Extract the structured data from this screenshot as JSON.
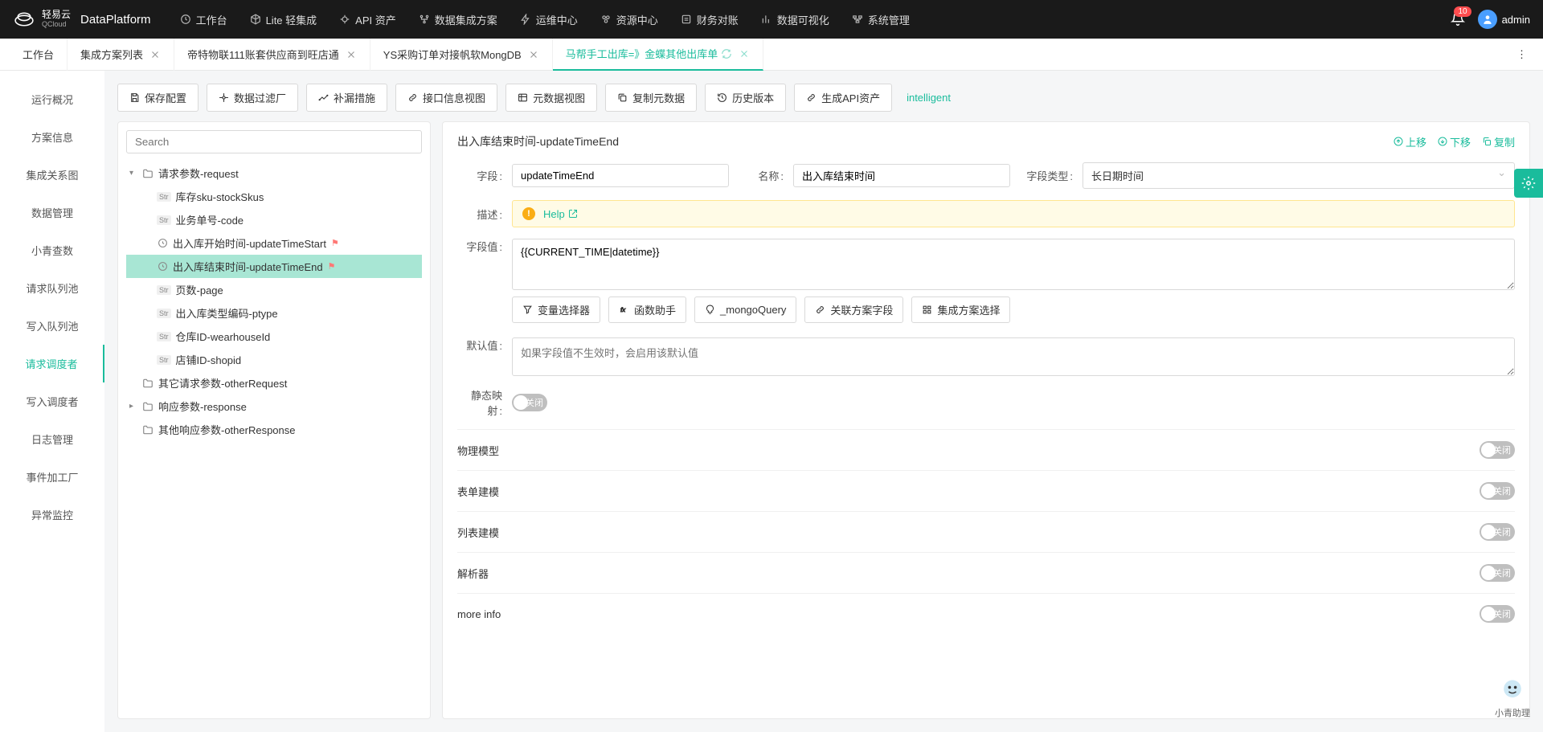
{
  "header": {
    "brand_cn": "轻易云",
    "brand_sub": "QCloud",
    "product": "DataPlatform",
    "nav": [
      {
        "icon": "clock",
        "label": "工作台"
      },
      {
        "icon": "cube",
        "label": "Lite 轻集成"
      },
      {
        "icon": "api",
        "label": "API 资产"
      },
      {
        "icon": "branch",
        "label": "数据集成方案"
      },
      {
        "icon": "bolt",
        "label": "运维中心"
      },
      {
        "icon": "resource",
        "label": "资源中心"
      },
      {
        "icon": "finance",
        "label": "财务对账"
      },
      {
        "icon": "chart",
        "label": "数据可视化"
      },
      {
        "icon": "system",
        "label": "系统管理"
      }
    ],
    "badge": "10",
    "user": "admin"
  },
  "tabs": [
    {
      "label": "工作台",
      "closable": false
    },
    {
      "label": "集成方案列表",
      "closable": true
    },
    {
      "label": "帝特物联111账套供应商到旺店通",
      "closable": true
    },
    {
      "label": "YS采购订单对接帆软MongDB",
      "closable": true
    },
    {
      "label": "马帮手工出库=》金蝶其他出库单",
      "closable": true,
      "active": true,
      "refresh": true
    }
  ],
  "sidebar": [
    "运行概况",
    "方案信息",
    "集成关系图",
    "数据管理",
    "小青查数",
    "请求队列池",
    "写入队列池",
    "请求调度者",
    "写入调度者",
    "日志管理",
    "事件加工厂",
    "异常监控"
  ],
  "sidebar_active_index": 7,
  "toolbar": [
    {
      "icon": "save",
      "label": "保存配置"
    },
    {
      "icon": "filter",
      "label": "数据过滤厂"
    },
    {
      "icon": "patch",
      "label": "补漏措施"
    },
    {
      "icon": "link",
      "label": "接口信息视图"
    },
    {
      "icon": "meta",
      "label": "元数据视图"
    },
    {
      "icon": "copy",
      "label": "复制元数据"
    },
    {
      "icon": "history",
      "label": "历史版本"
    },
    {
      "icon": "api",
      "label": "生成API资产"
    }
  ],
  "intelligent": "intelligent",
  "search_placeholder": "Search",
  "tree": {
    "root": [
      {
        "type": "folder",
        "label": "请求参数-request",
        "expanded": true,
        "children": [
          {
            "type": "str",
            "label": "库存sku-stockSkus"
          },
          {
            "type": "str",
            "label": "业务单号-code"
          },
          {
            "type": "clock",
            "label": "出入库开始时间-updateTimeStart",
            "flag": true
          },
          {
            "type": "clock",
            "label": "出入库结束时间-updateTimeEnd",
            "flag": true,
            "selected": true
          },
          {
            "type": "str",
            "label": "页数-page"
          },
          {
            "type": "str",
            "label": "出入库类型编码-ptype"
          },
          {
            "type": "str",
            "label": "仓库ID-wearhouseId"
          },
          {
            "type": "str",
            "label": "店铺ID-shopid"
          }
        ]
      },
      {
        "type": "folder",
        "label": "其它请求参数-otherRequest"
      },
      {
        "type": "folder",
        "label": "响应参数-response",
        "caret": true
      },
      {
        "type": "folder",
        "label": "其他响应参数-otherResponse"
      }
    ]
  },
  "detail": {
    "title": "出入库结束时间-updateTimeEnd",
    "actions": {
      "up": "上移",
      "down": "下移",
      "copy": "复制"
    },
    "labels": {
      "field": "字段",
      "name": "名称",
      "fieldType": "字段类型",
      "desc": "描述",
      "fieldValue": "字段值",
      "defaultValue": "默认值",
      "staticMap": "静态映射"
    },
    "field": "updateTimeEnd",
    "name": "出入库结束时间",
    "fieldType": "长日期时间",
    "help": "Help",
    "fieldValue": "{{CURRENT_TIME|datetime}}",
    "chips": [
      {
        "icon": "funnel",
        "label": "变量选择器"
      },
      {
        "icon": "fx",
        "label": "函数助手"
      },
      {
        "icon": "bulb",
        "label": "_mongoQuery"
      },
      {
        "icon": "link",
        "label": "关联方案字段"
      },
      {
        "icon": "grid",
        "label": "集成方案选择"
      }
    ],
    "defaultPlaceholder": "如果字段值不生效时，会启用该默认值",
    "toggleOff": "关闭",
    "sections": [
      "物理模型",
      "表单建模",
      "列表建模",
      "解析器",
      "more info"
    ]
  },
  "assistant": "小青助理"
}
